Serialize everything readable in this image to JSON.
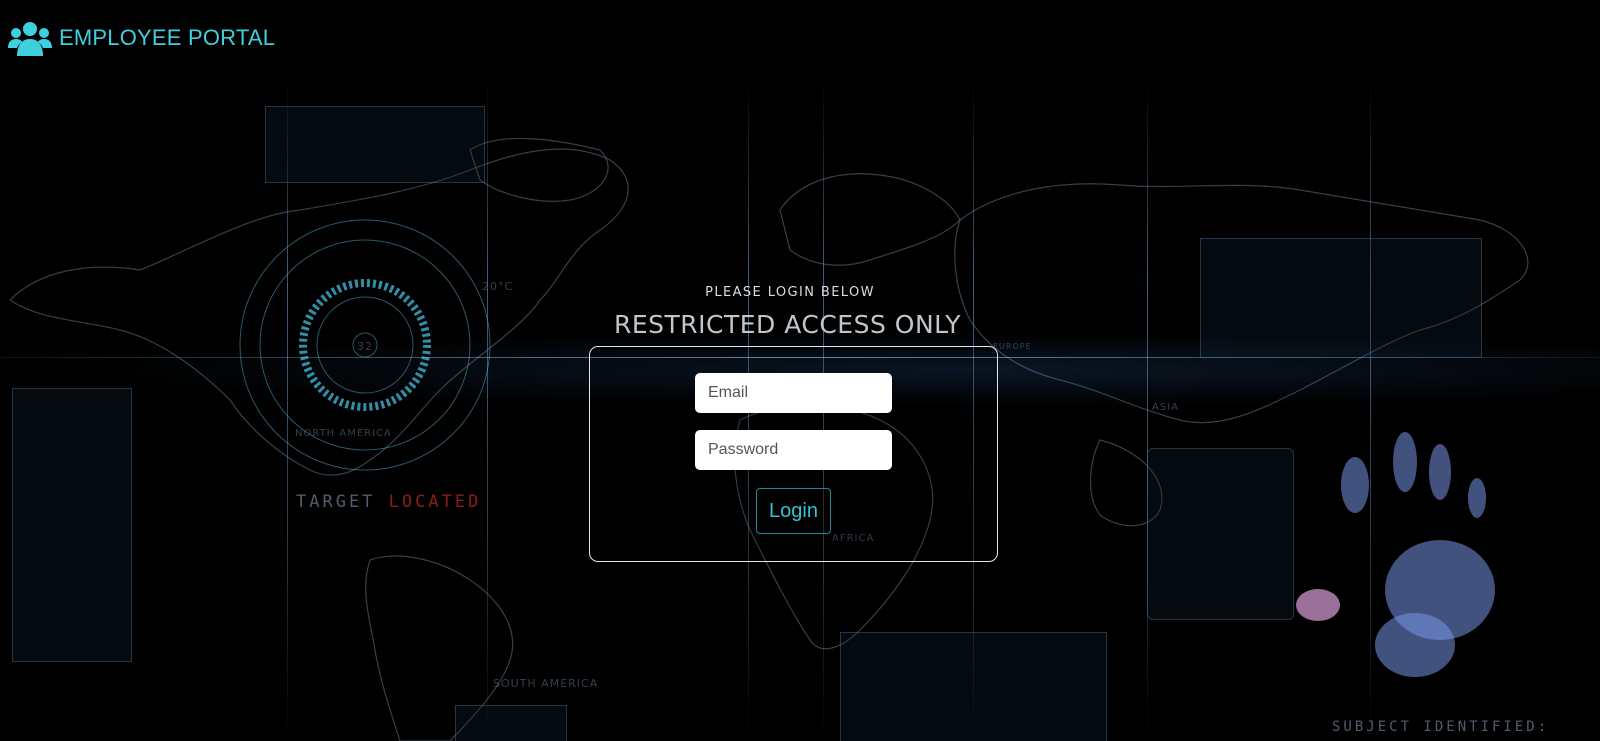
{
  "header": {
    "brand_icon": "users-icon",
    "title": "EMPLOYEE PORTAL",
    "accent_color": "#3fd0e0"
  },
  "login": {
    "subtitle": "PLEASE LOGIN BELOW",
    "title": "RESTRICTED ACCESS ONLY",
    "email_placeholder": "Email",
    "password_placeholder": "Password",
    "login_label": "Login"
  },
  "background": {
    "hud_target_prefix": "TARGET",
    "hud_target_status": "LOCATED",
    "hud_subject": "SUBJECT IDENTIFIED:",
    "temperature": "20°C",
    "dial_value": "32",
    "labels": {
      "north_america": "NORTH AMERICA",
      "south_america": "SOUTH AMERICA",
      "africa": "AFRICA",
      "asia": "ASIA",
      "europe": "EUROPE"
    }
  }
}
